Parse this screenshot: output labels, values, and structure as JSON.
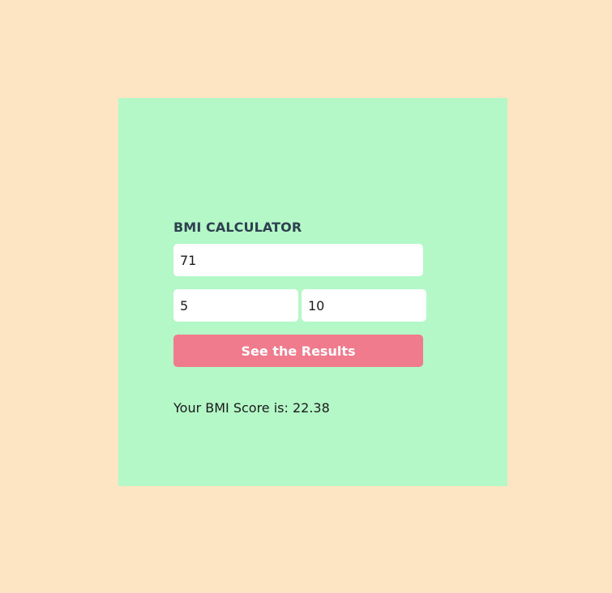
{
  "app": {
    "title": "BMI CALCULATOR"
  },
  "form": {
    "weight_value": "71",
    "height_feet_value": "5",
    "height_inches_value": "10",
    "submit_label": "See the Results"
  },
  "result": {
    "text": "Your BMI Score is: 22.38"
  },
  "colors": {
    "page_background": "#fde5c3",
    "panel_background": "#b4f8c8",
    "button_background": "#ef7b8d",
    "title_text": "#2e3f50"
  }
}
